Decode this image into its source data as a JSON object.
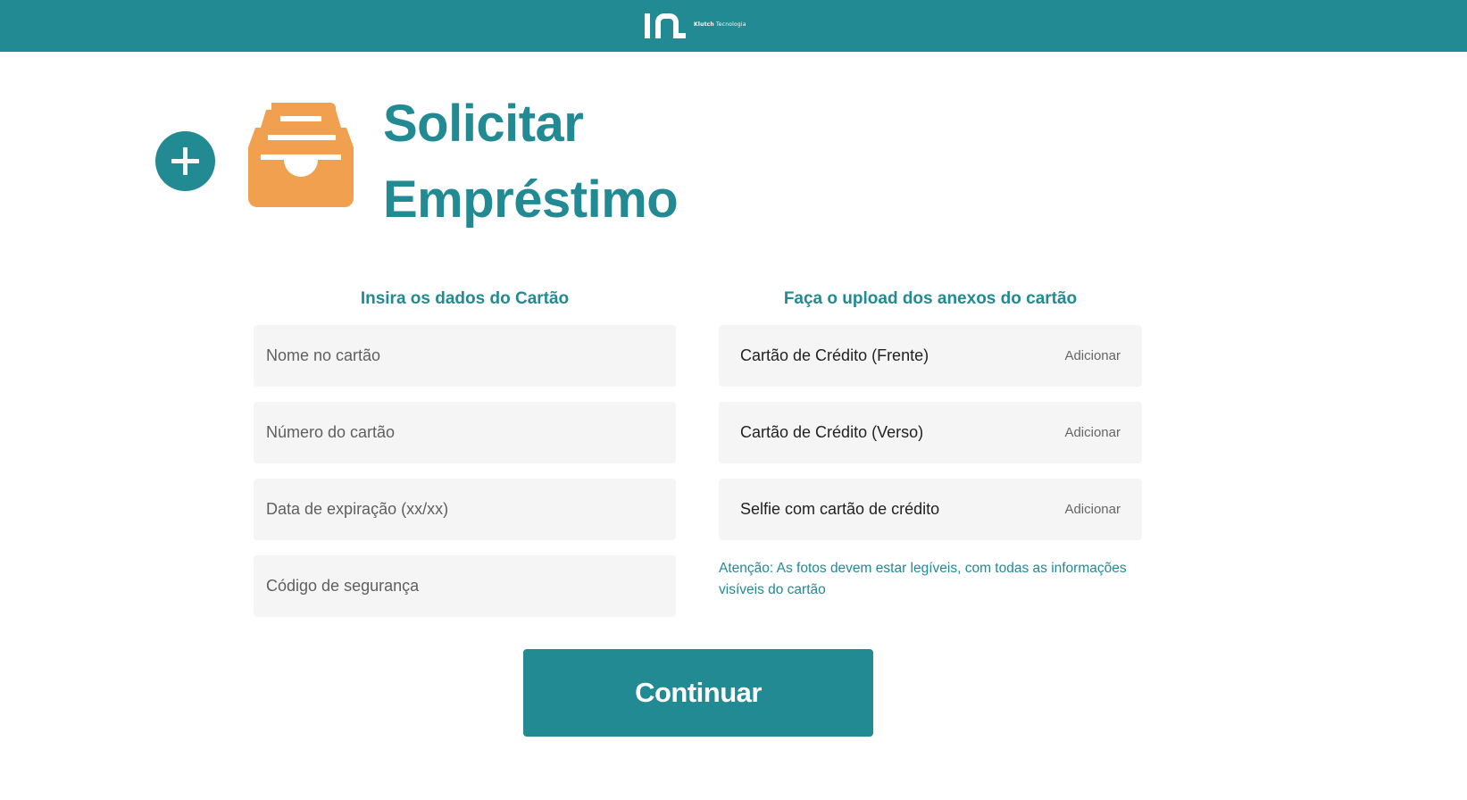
{
  "header": {
    "brand_name": "Klutch",
    "brand_suffix": "Tecnologia",
    "logo_icon": "klutch-logo-icon"
  },
  "page": {
    "title": "Solicitar Empréstimo",
    "add_icon": "plus-icon",
    "header_icon": "inbox-tray-icon"
  },
  "card_form": {
    "title": "Insira os dados do Cartão",
    "fields": [
      {
        "placeholder": "Nome no cartão",
        "value": ""
      },
      {
        "placeholder": "Número do cartão",
        "value": ""
      },
      {
        "placeholder": "Data de expiração (xx/xx)",
        "value": ""
      },
      {
        "placeholder": "Código de segurança",
        "value": ""
      }
    ]
  },
  "attachments": {
    "title": "Faça o upload dos anexos do cartão",
    "items": [
      {
        "label": "Cartão de Crédito (Frente)",
        "action": "Adicionar"
      },
      {
        "label": "Cartão de Crédito (Verso)",
        "action": "Adicionar"
      },
      {
        "label": "Selfie com cartão de crédito",
        "action": "Adicionar"
      }
    ],
    "note": "Atenção: As fotos devem estar legíveis, com todas as informações visíveis do cartão"
  },
  "actions": {
    "continue_label": "Continuar"
  },
  "colors": {
    "primary": "#218a93",
    "accent": "#f0a04f",
    "field_bg": "#f5f5f5",
    "background": "#ffffff"
  }
}
